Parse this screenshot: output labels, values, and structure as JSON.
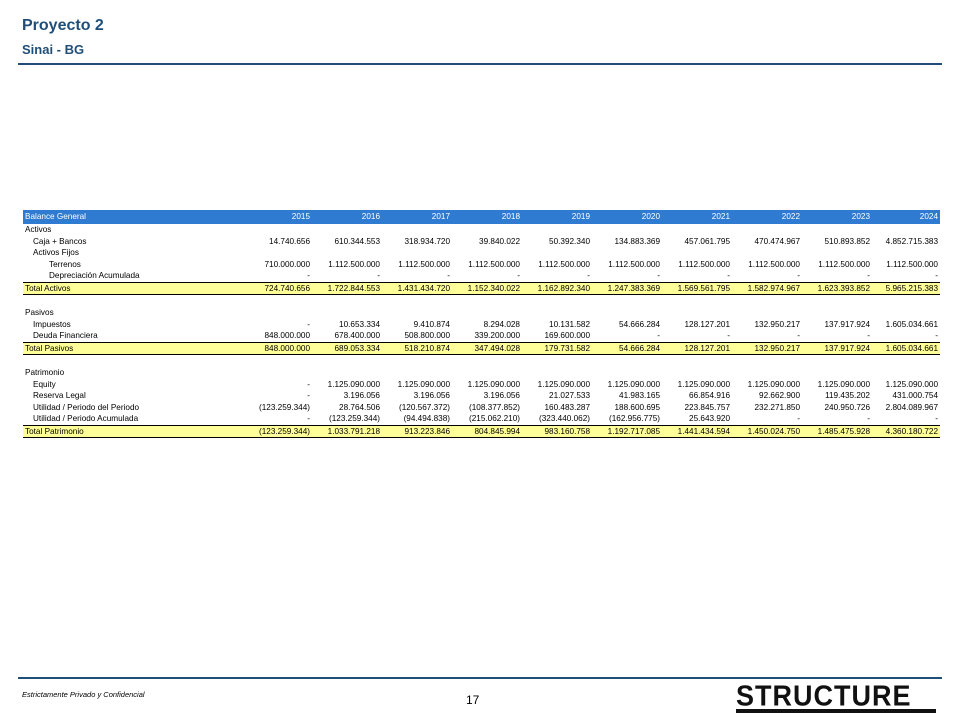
{
  "header": {
    "title": "Proyecto 2",
    "subtitle": "Sinai - BG"
  },
  "table": {
    "title": "Balance General",
    "years": [
      "2015",
      "2016",
      "2017",
      "2018",
      "2019",
      "2020",
      "2021",
      "2022",
      "2023",
      "2024"
    ],
    "rows": [
      {
        "type": "section",
        "label": "Activos"
      },
      {
        "type": "line",
        "level": 1,
        "label": "Caja + Bancos",
        "values": [
          "14.740.656",
          "610.344.553",
          "318.934.720",
          "39.840.022",
          "50.392.340",
          "134.883.369",
          "457.061.795",
          "470.474.967",
          "510.893.852",
          "4.852.715.383"
        ]
      },
      {
        "type": "line",
        "level": 1,
        "label": "Activos Fijos",
        "values": [
          "",
          "",
          "",
          "",
          "",
          "",
          "",
          "",
          "",
          ""
        ]
      },
      {
        "type": "line",
        "level": 2,
        "label": "Terrenos",
        "values": [
          "710.000.000",
          "1.112.500.000",
          "1.112.500.000",
          "1.112.500.000",
          "1.112.500.000",
          "1.112.500.000",
          "1.112.500.000",
          "1.112.500.000",
          "1.112.500.000",
          "1.112.500.000"
        ]
      },
      {
        "type": "line",
        "level": 2,
        "label": "Depreciación Acumulada",
        "values": [
          "-",
          "-",
          "-",
          "-",
          "-",
          "-",
          "-",
          "-",
          "-",
          "-"
        ]
      },
      {
        "type": "total",
        "label": "Total Activos",
        "values": [
          "724.740.656",
          "1.722.844.553",
          "1.431.434.720",
          "1.152.340.022",
          "1.162.892.340",
          "1.247.383.369",
          "1.569.561.795",
          "1.582.974.967",
          "1.623.393.852",
          "5.965.215.383"
        ]
      },
      {
        "type": "spacer"
      },
      {
        "type": "section",
        "label": "Pasivos"
      },
      {
        "type": "line",
        "level": 1,
        "label": "Impuestos",
        "values": [
          "-",
          "10.653.334",
          "9.410.874",
          "8.294.028",
          "10.131.582",
          "54.666.284",
          "128.127.201",
          "132.950.217",
          "137.917.924",
          "1.605.034.661"
        ]
      },
      {
        "type": "line",
        "level": 1,
        "label": "Deuda Financiera",
        "values": [
          "848.000.000",
          "678.400.000",
          "508.800.000",
          "339.200.000",
          "169.600.000",
          "-",
          "-",
          "-",
          "-",
          "-"
        ]
      },
      {
        "type": "total",
        "label": "Total Pasivos",
        "values": [
          "848.000.000",
          "689.053.334",
          "518.210.874",
          "347.494.028",
          "179.731.582",
          "54.666.284",
          "128.127.201",
          "132.950.217",
          "137.917.924",
          "1.605.034.661"
        ]
      },
      {
        "type": "spacer"
      },
      {
        "type": "section",
        "label": "Patrimonio"
      },
      {
        "type": "line",
        "level": 1,
        "label": "Equity",
        "values": [
          "-",
          "1.125.090.000",
          "1.125.090.000",
          "1.125.090.000",
          "1.125.090.000",
          "1.125.090.000",
          "1.125.090.000",
          "1.125.090.000",
          "1.125.090.000",
          "1.125.090.000"
        ]
      },
      {
        "type": "line",
        "level": 1,
        "label": "Reserva Legal",
        "values": [
          "-",
          "3.196.056",
          "3.196.056",
          "3.196.056",
          "21.027.533",
          "41.983.165",
          "66.854.916",
          "92.662.900",
          "119.435.202",
          "431.000.754"
        ]
      },
      {
        "type": "line",
        "level": 1,
        "label": "Utilidad / Periodo del Periodo",
        "values": [
          "(123.259.344)",
          "28.764.506",
          "(120.567.372)",
          "(108.377.852)",
          "160.483.287",
          "188.600.695",
          "223.845.757",
          "232.271.850",
          "240.950.726",
          "2.804.089.967"
        ]
      },
      {
        "type": "line",
        "level": 1,
        "label": "Utilidad / Periodo Acumulada",
        "values": [
          "-",
          "(123.259.344)",
          "(94.494.838)",
          "(215.062.210)",
          "(323.440.062)",
          "(162.956.775)",
          "25.643.920",
          "-",
          "-",
          "-"
        ]
      },
      {
        "type": "total",
        "label": "Total Patrimonio",
        "values": [
          "(123.259.344)",
          "1.033.791.218",
          "913.223.846",
          "804.845.994",
          "983.160.758",
          "1.192.717.085",
          "1.441.434.594",
          "1.450.024.750",
          "1.485.475.928",
          "4.360.180.722"
        ]
      }
    ]
  },
  "footer": {
    "note": "Estrictamente Privado y Confidencial",
    "page": "17",
    "logo": "STRUCTURE"
  },
  "colors": {
    "header_blue": "#2e7bd1",
    "total_yellow": "#ffff99",
    "title_navy": "#1f4e79"
  }
}
